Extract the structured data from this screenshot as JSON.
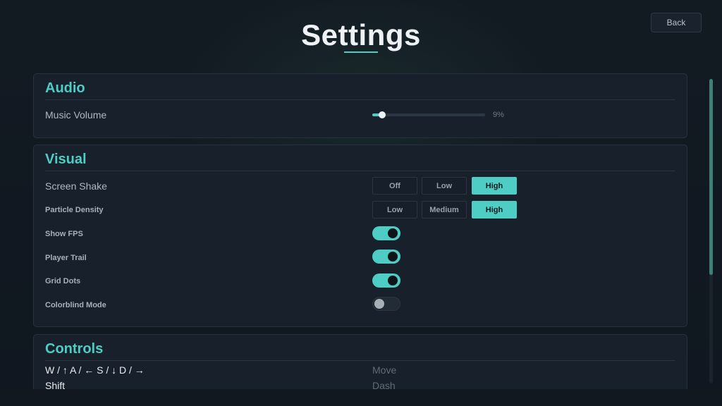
{
  "page": {
    "title": "Settings",
    "back_label": "Back"
  },
  "colors": {
    "accent": "#4ecdc4",
    "panel_bg": "#18212b",
    "background": "#111820"
  },
  "audio": {
    "title": "Audio",
    "music_volume": {
      "label": "Music Volume",
      "value_text": "9%",
      "value_percent": 9
    }
  },
  "visual": {
    "title": "Visual",
    "screen_shake": {
      "label": "Screen Shake",
      "options": [
        "Off",
        "Low",
        "High"
      ],
      "selected": "High"
    },
    "particle_density": {
      "label": "Particle Density",
      "options": [
        "Low",
        "Medium",
        "High"
      ],
      "selected": "High"
    },
    "show_fps": {
      "label": "Show FPS",
      "enabled": true
    },
    "player_trail": {
      "label": "Player Trail",
      "enabled": true
    },
    "grid_dots": {
      "label": "Grid Dots",
      "enabled": true
    },
    "colorblind_mode": {
      "label": "Colorblind Mode",
      "enabled": false
    }
  },
  "controls": {
    "title": "Controls",
    "bindings": [
      {
        "keys": "W / ↑  A / ←  S / ↓  D / →",
        "action": "Move"
      },
      {
        "keys": "Shift",
        "action": "Dash"
      }
    ]
  }
}
